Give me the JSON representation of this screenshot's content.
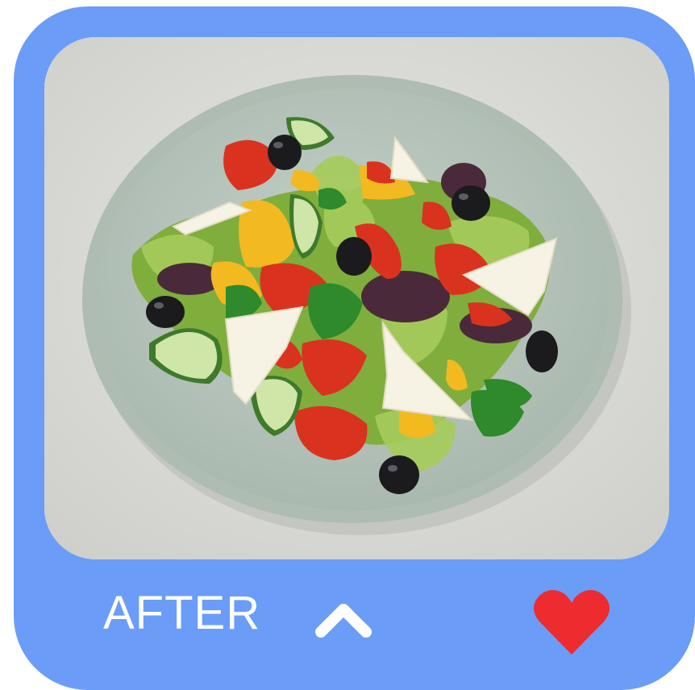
{
  "card": {
    "background_color": "#6b9cf7",
    "photo_subject": "greek-salad-on-plate"
  },
  "footer": {
    "label": "AFTER",
    "label_color": "#ffffff",
    "toggle_icon": "chevron-up-icon",
    "like_icon": "heart-icon",
    "like_color": "#ee2b2f"
  }
}
